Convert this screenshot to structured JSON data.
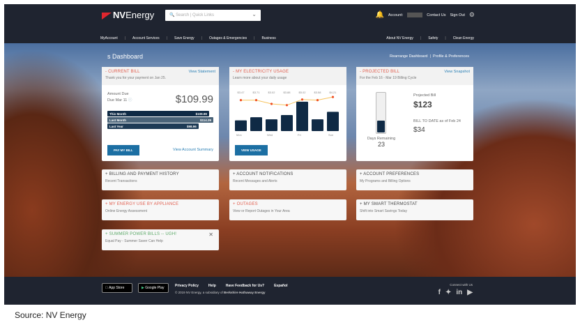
{
  "header": {
    "brand": "NVEnergy",
    "brand_a": "NV",
    "brand_b": "Energy",
    "search_placeholder": "Search | Quick Links",
    "account_label": "Account:",
    "contact": "Contact Us",
    "signout": "Sign Out",
    "bell_count": "1"
  },
  "nav_left": [
    "MyAccount",
    "Account Services",
    "Save Energy",
    "Outages & Emergencies",
    "Business"
  ],
  "nav_right": [
    "About NV Energy",
    "Safety",
    "Clean Energy"
  ],
  "dashboard": {
    "title": "s Dashboard",
    "rearrange": "Rearrange Dashboard",
    "profile": "Profile & Preferences"
  },
  "current_bill": {
    "title": "- CURRENT BILL",
    "link": "View Statement",
    "subtitle": "Thank you for your payment on Jan 25.",
    "amount_label": "Amount Due",
    "due": "Due Mar 11",
    "amount": "$109.99",
    "rows": [
      {
        "label": "This Month",
        "value": "$109.99",
        "fraction": 0.96
      },
      {
        "label": "Last Month",
        "value": "$114.39",
        "fraction": 1.0
      },
      {
        "label": "Last Year",
        "value": "$98.96",
        "fraction": 0.86
      }
    ],
    "pay": "PAY MY BILL",
    "summary": "View Account Summary"
  },
  "usage": {
    "title": "- MY ELECTRICITY USAGE",
    "subtitle": "Learn more about your daily usage",
    "button": "VIEW USAGE"
  },
  "chart_data": {
    "type": "bar",
    "categories": [
      "Mon",
      "Tue",
      "Wed",
      "Thu",
      "Fri",
      "Sat",
      "Sun"
    ],
    "x_labels": [
      "Mon",
      "",
      "Wed",
      "",
      "Fri",
      "",
      "Sun"
    ],
    "cost_labels": [
      "$3.47",
      "$3.71",
      "$3.02",
      "$3.88",
      "$5.02",
      "$3.58",
      "$4.21"
    ],
    "values": [
      2.0,
      2.6,
      2.2,
      3.0,
      5.5,
      2.2,
      3.6
    ],
    "line_values": [
      3.6,
      3.6,
      3.0,
      2.8,
      3.7,
      3.6,
      4.1
    ]
  },
  "projected": {
    "title": "- PROJECTED BILL",
    "link": "View Snapshot",
    "subtitle": "For the Feb 16 - Mar 19 Billing Cycle",
    "days_label": "Days Remaining",
    "days": "23",
    "cycle_fraction": 0.3,
    "proj_label": "Projected Bill",
    "proj": "$123",
    "todate_label": "BILL TO DATE as of Feb 24",
    "todate": "$34"
  },
  "tiles": [
    {
      "title": "+ BILLING AND PAYMENT HISTORY",
      "sub": "Recent Transactions",
      "color": "dark"
    },
    {
      "title": "+ ACCOUNT NOTIFICATIONS",
      "sub": "Recent Messages and Alerts",
      "color": "dark"
    },
    {
      "title": "+ ACCOUNT PREFERENCES",
      "sub": "My Programs and Billing Options",
      "color": "dark"
    },
    {
      "title": "+ MY ENERGY USE BY APPLIANCE",
      "sub": "Online Energy Assessment",
      "color": "red"
    },
    {
      "title": "+ OUTAGES",
      "sub": "View or Report Outages in Your Area",
      "color": "red"
    },
    {
      "title": "+ MY SMART THERMOSTAT",
      "sub": "Shift into Smart Savings Today",
      "color": "dark"
    },
    {
      "title": "+ SUMMER POWER BILLS -- UGH!",
      "sub": "Equal Pay - Summer Saver Can Help",
      "color": "green"
    }
  ],
  "footer": {
    "appstore": "App Store",
    "googleplay": "Google Play",
    "links": [
      "Privacy Policy",
      "Help",
      "Have Feedback for Us?",
      "Español"
    ],
    "copyright": "© 2019 NV Energy, a subsidiary of ",
    "parent": "Berkshire Hathaway Energy",
    "connect": "Connect with Us"
  },
  "caption": "Source: NV Energy"
}
